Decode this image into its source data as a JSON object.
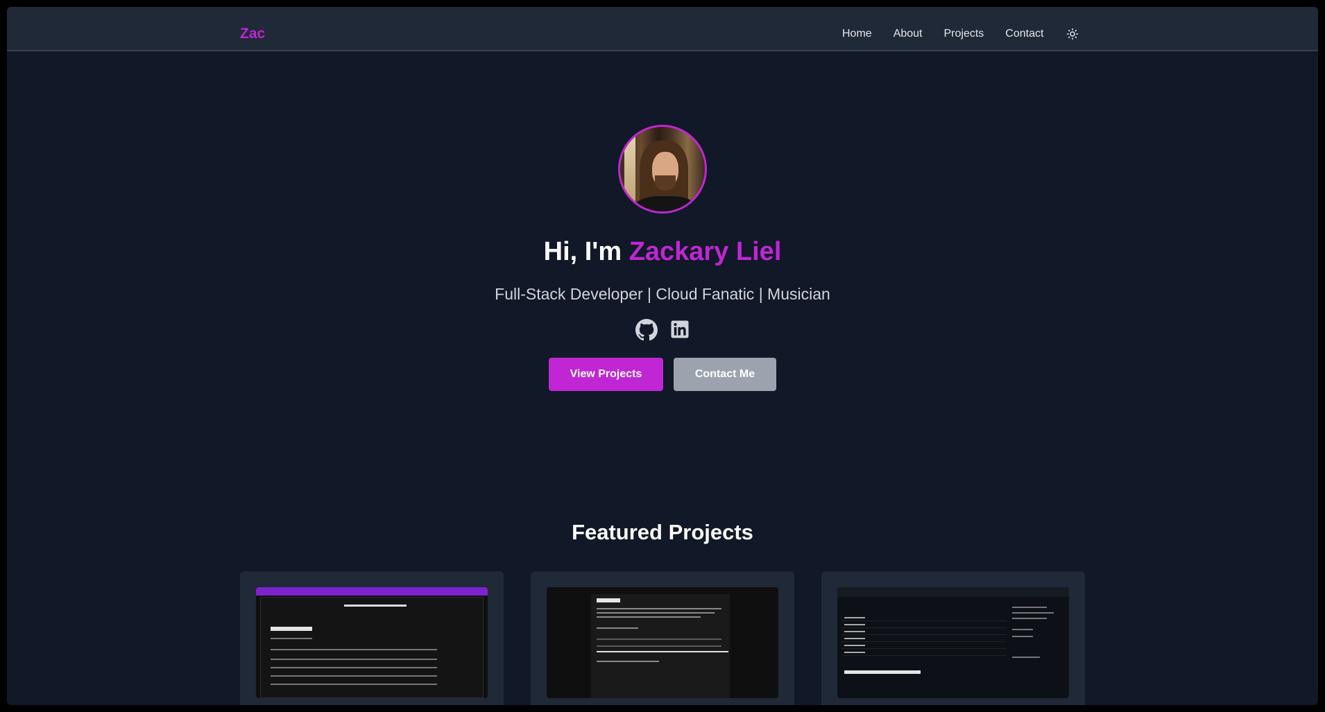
{
  "nav": {
    "logo": "Zac",
    "links": [
      "Home",
      "About",
      "Projects",
      "Contact"
    ],
    "theme_icon": "sun-icon"
  },
  "hero": {
    "greeting": "Hi, I'm ",
    "name": "Zackary Liel",
    "tagline": "Full-Stack Developer | Cloud Fanatic | Musician",
    "socials": [
      "github-icon",
      "linkedin-icon"
    ],
    "primary_button": "View Projects",
    "secondary_button": "Contact Me"
  },
  "projects": {
    "title": "Featured Projects"
  },
  "colors": {
    "background": "#111827",
    "navbar": "#1f2937",
    "accent": "#c026d3",
    "secondary_button": "#9ca3af",
    "text": "#ffffff"
  }
}
